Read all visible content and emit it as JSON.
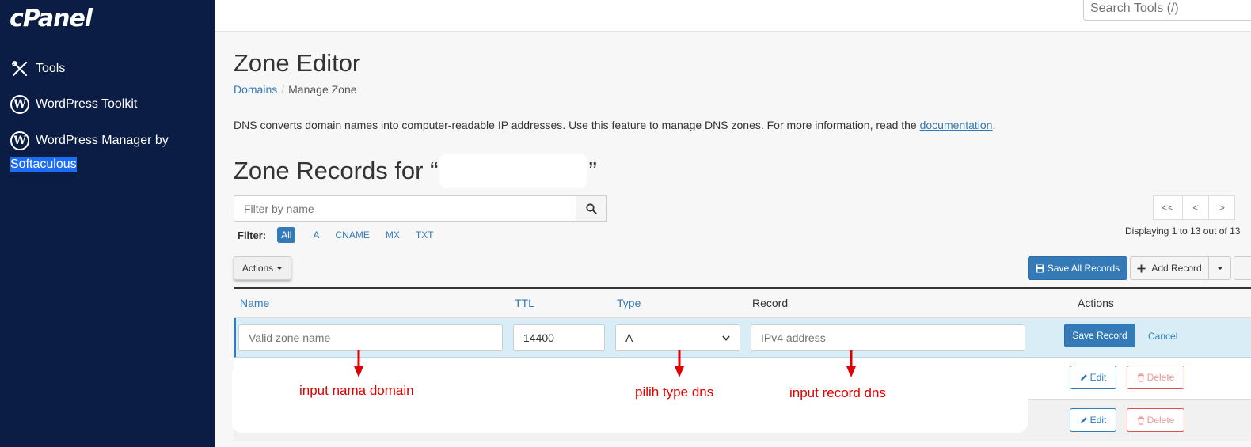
{
  "sidebar": {
    "logo": "cPanel",
    "items": [
      {
        "label": "Tools",
        "icon": "tools-icon"
      },
      {
        "label": "WordPress Toolkit",
        "icon": "wordpress-icon"
      },
      {
        "label": "WordPress Manager by",
        "icon": "wordpress-icon"
      }
    ],
    "softaculous": "Softaculous"
  },
  "topbar": {
    "search_placeholder": "Search Tools (/)"
  },
  "page": {
    "title": "Zone Editor",
    "breadcrumb": [
      "Domains",
      "Manage Zone"
    ],
    "description": "DNS converts domain names into computer-readable IP addresses. Use this feature to manage DNS zones. For more information, read the ",
    "description_link": "documentation",
    "description_end": ".",
    "records_title_prefix": "Zone Records for “",
    "records_title_suffix": "”"
  },
  "filter": {
    "placeholder": "Filter by name",
    "label": "Filter:",
    "chips": [
      "All",
      "A",
      "CNAME",
      "MX",
      "TXT"
    ],
    "active": "All"
  },
  "pager": {
    "buttons": [
      "<<",
      "<",
      ">"
    ],
    "displaying": "Displaying 1 to 13 out of 13"
  },
  "toolbar": {
    "actions": "Actions",
    "save_all": "Save All Records",
    "add_record": "Add Record"
  },
  "table": {
    "headers": {
      "name": "Name",
      "ttl": "TTL",
      "type": "Type",
      "record": "Record",
      "actions": "Actions"
    },
    "edit_row": {
      "name_placeholder": "Valid zone name",
      "ttl_value": "14400",
      "type_value": "A",
      "record_placeholder": "IPv4 address",
      "save": "Save Record",
      "cancel": "Cancel"
    },
    "row_actions": {
      "edit": "Edit",
      "delete": "Delete"
    }
  },
  "annotations": {
    "name": "input nama domain",
    "type": "pilih type dns",
    "record": "input record dns",
    "color": "#e00000"
  },
  "colors": {
    "sidebar": "#0b1d44",
    "primary": "#337ab7",
    "danger": "#d9534f"
  }
}
